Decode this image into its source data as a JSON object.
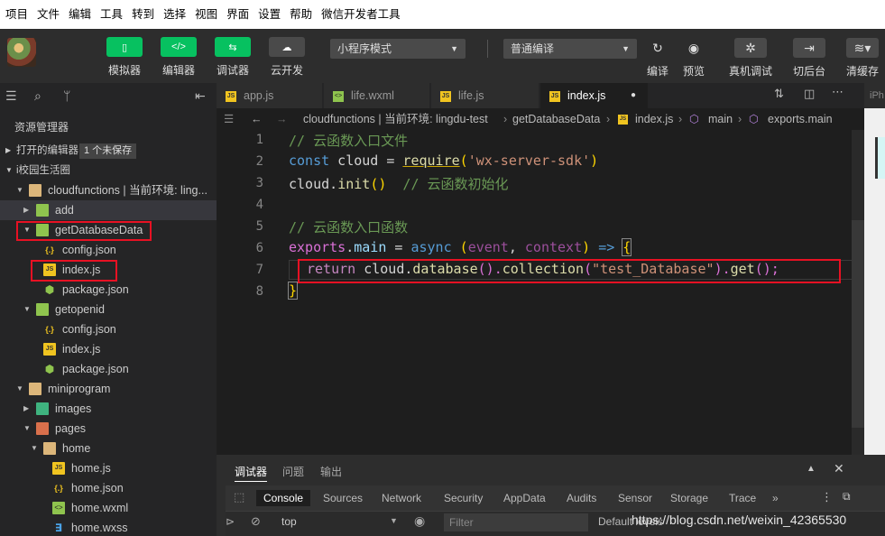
{
  "menubar": [
    "项目",
    "文件",
    "编辑",
    "工具",
    "转到",
    "选择",
    "视图",
    "界面",
    "设置",
    "帮助",
    "微信开发者工具"
  ],
  "toolbar": {
    "left_buttons": [
      {
        "label": "模拟器",
        "icon": "phone-icon"
      },
      {
        "label": "编辑器",
        "icon": "code-icon"
      },
      {
        "label": "调试器",
        "icon": "debug-icon"
      },
      {
        "label": "云开发",
        "icon": "cloud-icon"
      }
    ],
    "mode_select": "小程序模式",
    "compile_select": "普通编译",
    "right_buttons": [
      {
        "label": "编译",
        "icon": "refresh-icon"
      },
      {
        "label": "预览",
        "icon": "eye-icon"
      },
      {
        "label": "真机调试",
        "icon": "bug-icon"
      },
      {
        "label": "切后台",
        "icon": "switch-icon"
      },
      {
        "label": "清缓存",
        "icon": "layers-icon"
      }
    ]
  },
  "sidebar": {
    "title": "资源管理器",
    "open_editors": "打开的编辑器",
    "unsaved": "1 个未保存",
    "project": "i校园生活圈",
    "tree": [
      {
        "label": "cloudfunctions | 当前环境: ling...",
        "depth": 1,
        "type": "folder",
        "open": true
      },
      {
        "label": "add",
        "depth": 2,
        "type": "cloudfolder",
        "open": false,
        "hl": true
      },
      {
        "label": "getDatabaseData",
        "depth": 2,
        "type": "cloudfolder",
        "open": true
      },
      {
        "label": "config.json",
        "depth": 3,
        "type": "json"
      },
      {
        "label": "index.js",
        "depth": 3,
        "type": "js"
      },
      {
        "label": "package.json",
        "depth": 3,
        "type": "pkg"
      },
      {
        "label": "getopenid",
        "depth": 2,
        "type": "cloudfolder",
        "open": true
      },
      {
        "label": "config.json",
        "depth": 3,
        "type": "json"
      },
      {
        "label": "index.js",
        "depth": 3,
        "type": "js"
      },
      {
        "label": "package.json",
        "depth": 3,
        "type": "pkg"
      },
      {
        "label": "miniprogram",
        "depth": 1,
        "type": "folder",
        "open": true
      },
      {
        "label": "images",
        "depth": 2,
        "type": "imgfolder",
        "open": false
      },
      {
        "label": "pages",
        "depth": 2,
        "type": "pagefolder",
        "open": true
      },
      {
        "label": "home",
        "depth": 3,
        "type": "folder",
        "open": true
      },
      {
        "label": "home.js",
        "depth": 4,
        "type": "js"
      },
      {
        "label": "home.json",
        "depth": 4,
        "type": "json"
      },
      {
        "label": "home.wxml",
        "depth": 4,
        "type": "wxml"
      },
      {
        "label": "home.wxss",
        "depth": 4,
        "type": "wxss"
      }
    ]
  },
  "tabs": [
    {
      "label": "app.js",
      "type": "js"
    },
    {
      "label": "life.wxml",
      "type": "wxml"
    },
    {
      "label": "life.js",
      "type": "js"
    },
    {
      "label": "index.js",
      "type": "js",
      "active": true
    }
  ],
  "breadcrumb": [
    "cloudfunctions | 当前环境: lingdu-test",
    "getDatabaseData",
    "index.js",
    "main",
    "exports.main"
  ],
  "code": {
    "line_numbers": [
      "1",
      "2",
      "3",
      "4",
      "5",
      "6",
      "7",
      "8"
    ],
    "l1": "// 云函数入口文件",
    "l2a": "const",
    "l2b": " cloud = ",
    "l2c": "require",
    "l2d": "(",
    "l2e": "'wx-server-sdk'",
    "l2f": ")",
    "l3a": "cloud.",
    "l3b": "init",
    "l3c": "()",
    "l3d": "  // 云函数初始化",
    "l5": "// 云函数入口函数",
    "l6a": "exports",
    "l6b": ".",
    "l6c": "main",
    "l6d": " = ",
    "l6e": "async",
    "l6f": " (",
    "l6g": "event",
    "l6h": ", ",
    "l6i": "context",
    "l6j": ") ",
    "l6k": "=>",
    "l6l": " ",
    "l6m": "{",
    "l7a": "return",
    "l7b": " cloud.",
    "l7c": "database",
    "l7d": "().",
    "l7e": "collection",
    "l7f": "(",
    "l7g": "\"test_Database\"",
    "l7h": ").",
    "l7i": "get",
    "l7j": "();",
    "l8": "}"
  },
  "preview_label": "iPh",
  "devtools": {
    "tabs": [
      "调试器",
      "问题",
      "输出"
    ],
    "inner_tabs": [
      "Console",
      "Sources",
      "Network",
      "Security",
      "AppData",
      "Audits",
      "Sensor",
      "Storage",
      "Trace"
    ],
    "more": "»",
    "context": "top",
    "filter_placeholder": "Filter",
    "level": "Default levels",
    "watermark": "https://blog.csdn.net/weixin_42365530"
  }
}
